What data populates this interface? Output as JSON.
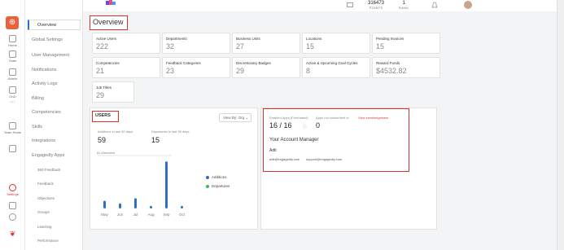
{
  "rail": {
    "items": [
      {
        "label": "Home",
        "icon": "home-icon"
      },
      {
        "label": "Team",
        "icon": "team-icon"
      },
      {
        "label": "Admin",
        "icon": "admin-icon"
      },
      {
        "label": "OnD",
        "icon": "ond-icon"
      },
      {
        "label": "",
        "icon": "more-icon"
      },
      {
        "label": "Team Home",
        "icon": "team-home-icon"
      },
      {
        "label": "",
        "icon": "grid-icon"
      },
      {
        "label": "Settings",
        "icon": "settings-icon"
      },
      {
        "label": "",
        "icon": "download-icon"
      },
      {
        "label": "",
        "icon": "gear-icon"
      }
    ]
  },
  "menu": {
    "items": [
      "Overview",
      "Global Settings",
      "User Management",
      "Notifications",
      "Activity Logs",
      "Billing",
      "Competencies",
      "Skills",
      "Integrations",
      "Engagedly Apps",
      "360 Feedback",
      "Feedback",
      "Objectives",
      "Groups",
      "Learning",
      "Performance"
    ]
  },
  "topbar": {
    "points_value": "316473",
    "points_label": "POINTS",
    "rank_value": "1",
    "rank_label": "RANK"
  },
  "page_title": "Overview",
  "cards": [
    {
      "title": "Active Users",
      "value": "222"
    },
    {
      "title": "Departments",
      "value": "32"
    },
    {
      "title": "Business Units",
      "value": "27"
    },
    {
      "title": "Locations",
      "value": "15"
    },
    {
      "title": "Pending Invoices",
      "value": "15"
    },
    {
      "title": "Competencies",
      "value": "21"
    },
    {
      "title": "Feedback Categories",
      "value": "23"
    },
    {
      "title": "Discretionary Badges",
      "value": "29"
    },
    {
      "title": "Active & Upcoming Goal Cycles",
      "value": "8"
    },
    {
      "title": "Reward Funds",
      "value": "$4532.82"
    },
    {
      "title": "Job Titles",
      "value": "29"
    }
  ],
  "users": {
    "label": "USERS",
    "view_by": "View By: Org",
    "additions_label": "Additions in last 30 days",
    "additions_value": "59",
    "departures_label": "Departures in last 30 days",
    "departures_value": "15",
    "chart_caption": "81 Members"
  },
  "chart_data": {
    "type": "bar",
    "categories": [
      "May",
      "Jun",
      "Jul",
      "Aug",
      "Sep",
      "Oct"
    ],
    "series": [
      {
        "name": "Additions",
        "color": "#2f6fc4",
        "values": [
          9,
          6,
          12,
          3,
          55,
          3
        ]
      },
      {
        "name": "Departures",
        "color": "#3dbb4a",
        "values": [
          0,
          0,
          0,
          0,
          0,
          0
        ]
      }
    ],
    "title": "81 Members",
    "xlabel": "",
    "ylabel": "",
    "ylim": [
      0,
      60
    ],
    "grid": false,
    "legend": "right"
  },
  "apps": {
    "enabled_label": "Enabled Apps (Purchased)",
    "enabled_value": "16 / 16",
    "unsub_label": "Apps not subscribed to",
    "unsub_value": "0",
    "knowledgebase_link": "View knowledgebase",
    "account_manager_title": "Your Account Manager",
    "manager_name": "Adit",
    "manager_email": "adit@engagedly.com",
    "support_email": "support@engagedly.com"
  }
}
